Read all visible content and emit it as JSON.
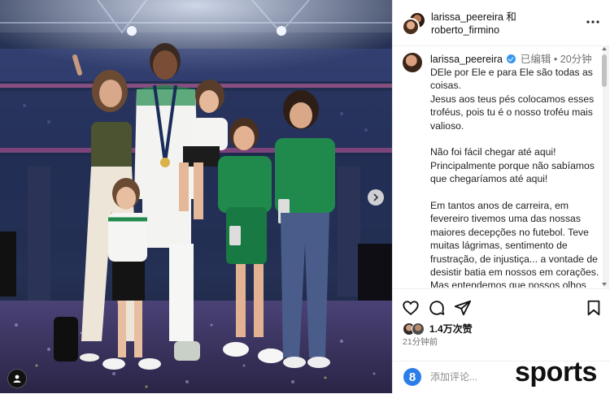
{
  "header": {
    "user1": "larissa_peereira",
    "joiner": "和",
    "user2": "roberto_firmino"
  },
  "caption": {
    "username": "larissa_peereira",
    "edited": "已编辑",
    "separator": "•",
    "time": "20分钟",
    "paragraphs": [
      "DEle por Ele e para Ele são todas as coisas.\nJesus aos teus pés colocamos esses troféus, pois tu é o nosso troféu mais valioso.",
      "Não foi fácil chegar até aqui!\nPrincipalmente porque não sabíamos que chegaríamos até aqui!",
      "Em tantos anos de carreira, em fevereiro tivemos uma das nossas maiores decepções no futebol. Teve muitas lágrimas, sentimento de frustração, de injustiça... a vontade de desistir batia em nossos em corações.\nMas entendemos que nossos olhos deviam estar fixos em Jesus e no"
    ]
  },
  "engagement": {
    "likes": "1.4万次赞",
    "time_ago": "21分钟前"
  },
  "comment": {
    "placeholder": "添加评论..."
  },
  "watermark": {
    "text": "sports"
  },
  "icons": [
    "heart-icon",
    "comment-icon",
    "share-icon",
    "bookmark-icon",
    "more-icon",
    "chevron-right-icon",
    "user-tag-icon",
    "emoji-icon",
    "verified-icon"
  ],
  "colors": {
    "verified": "#3897f0",
    "meta_gray": "#737373",
    "jersey_green": "#1f8a4c",
    "stage_confetti": "#7a6fb0"
  }
}
